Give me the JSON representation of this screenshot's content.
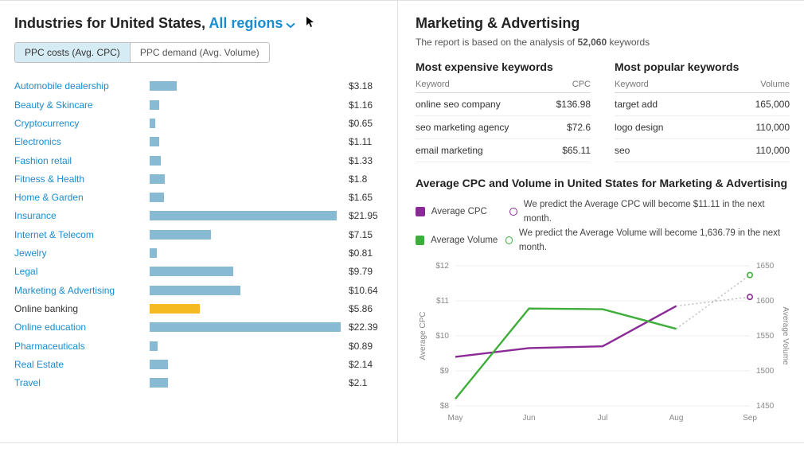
{
  "left": {
    "title_pre": "Industries for United States, ",
    "region": "All regions",
    "tabs": {
      "cpc": "PPC costs (Avg. CPC)",
      "demand": "PPC demand (Avg. Volume)"
    },
    "selected_tab": "cpc",
    "max_value": 22.39,
    "selected_index": 12,
    "rows": [
      {
        "label": "Automobile dealership",
        "value": 3.18,
        "display": "$3.18"
      },
      {
        "label": "Beauty & Skincare",
        "value": 1.16,
        "display": "$1.16"
      },
      {
        "label": "Cryptocurrency",
        "value": 0.65,
        "display": "$0.65"
      },
      {
        "label": "Electronics",
        "value": 1.11,
        "display": "$1.11"
      },
      {
        "label": "Fashion retail",
        "value": 1.33,
        "display": "$1.33"
      },
      {
        "label": "Fitness & Health",
        "value": 1.8,
        "display": "$1.8"
      },
      {
        "label": "Home & Garden",
        "value": 1.65,
        "display": "$1.65"
      },
      {
        "label": "Insurance",
        "value": 21.95,
        "display": "$21.95"
      },
      {
        "label": "Internet & Telecom",
        "value": 7.15,
        "display": "$7.15"
      },
      {
        "label": "Jewelry",
        "value": 0.81,
        "display": "$0.81"
      },
      {
        "label": "Legal",
        "value": 9.79,
        "display": "$9.79"
      },
      {
        "label": "Marketing & Advertising",
        "value": 10.64,
        "display": "$10.64"
      },
      {
        "label": "Online banking",
        "value": 5.86,
        "display": "$5.86"
      },
      {
        "label": "Online education",
        "value": 22.39,
        "display": "$22.39"
      },
      {
        "label": "Pharmaceuticals",
        "value": 0.89,
        "display": "$0.89"
      },
      {
        "label": "Real Estate",
        "value": 2.14,
        "display": "$2.14"
      },
      {
        "label": "Travel",
        "value": 2.1,
        "display": "$2.1"
      }
    ]
  },
  "right": {
    "title": "Marketing & Advertising",
    "report_prefix": "The report is based on the analysis of ",
    "report_count": "52,060",
    "report_suffix": " keywords",
    "expensive": {
      "title": "Most expensive keywords",
      "col1": "Keyword",
      "col2": "CPC",
      "rows": [
        {
          "k": "online seo company",
          "v": "$136.98"
        },
        {
          "k": "seo marketing agency",
          "v": "$72.6"
        },
        {
          "k": "email marketing",
          "v": "$65.11"
        }
      ]
    },
    "popular": {
      "title": "Most popular keywords",
      "col1": "Keyword",
      "col2": "Volume",
      "rows": [
        {
          "k": "target add",
          "v": "165,000"
        },
        {
          "k": "logo design",
          "v": "110,000"
        },
        {
          "k": "seo",
          "v": "110,000"
        }
      ]
    },
    "chart_title": "Average CPC and Volume in United States for Marketing & Advertising",
    "legend": {
      "cpc_label": "Average CPC",
      "vol_label": "Average Volume",
      "cpc_pred": "We predict the Average CPC will become $11.11 in the next month.",
      "vol_pred": "We predict the Average Volume will become 1,636.79 in the next month."
    }
  },
  "chart_data": {
    "type": "line",
    "title": "Average CPC and Volume in United States for Marketing & Advertising",
    "x": [
      "May",
      "Jun",
      "Jul",
      "Aug",
      "Sep"
    ],
    "y_left": {
      "label": "Average CPC",
      "ticks": [
        "$8",
        "$9",
        "$10",
        "$11",
        "$12"
      ],
      "range": [
        8,
        12
      ]
    },
    "y_right": {
      "label": "Average Volume",
      "ticks": [
        "1450",
        "1500",
        "1550",
        "1600",
        "1650"
      ],
      "range": [
        1450,
        1650
      ]
    },
    "series": [
      {
        "name": "Average CPC",
        "axis": "left",
        "color": "#8a2a96",
        "values": [
          9.4,
          9.65,
          9.7,
          10.85,
          11.11
        ],
        "predicted_index": 4
      },
      {
        "name": "Average Volume",
        "axis": "right",
        "color": "#3eae3a",
        "values": [
          1460,
          1589,
          1588,
          1560,
          1636.79
        ],
        "predicted_index": 4
      }
    ]
  }
}
